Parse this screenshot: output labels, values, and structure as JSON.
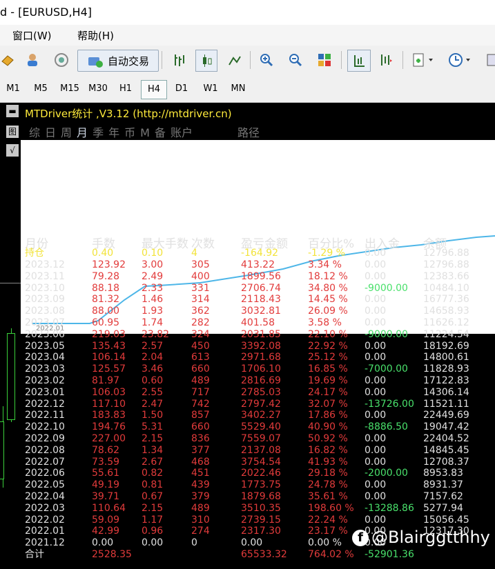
{
  "window": {
    "title": "d - [EURUSD,H4]"
  },
  "menu": {
    "window": "窗口(W)",
    "help": "帮助(H)"
  },
  "toolbar": {
    "autotrade_label": "自动交易"
  },
  "timeframes": [
    "M1",
    "M5",
    "M15",
    "M30",
    "H1",
    "H4",
    "D1",
    "W1",
    "MN"
  ],
  "active_timeframe": "H4",
  "indicator": {
    "title": "MTDriver统计 ,V3.12 (http://mtdriver.cn)",
    "tabs": [
      "综",
      "日",
      "周",
      "月",
      "季",
      "年",
      "币",
      "M",
      "备",
      "账户"
    ],
    "active_tab": "月",
    "path_label": "路径",
    "equity_x_label": "2022.01",
    "equity_line_color": "#4db6e8"
  },
  "table": {
    "headers": [
      "月份",
      "手数",
      "最大手数",
      "次数",
      "盈亏金额",
      "百分比%",
      "出入金",
      "余额"
    ],
    "position_row": [
      "持仓",
      "0.40",
      "0.10",
      "4",
      "-164.92",
      "-1.29 %",
      "0.00",
      "12796.88"
    ],
    "rows": [
      [
        "2023.12",
        "123.92",
        "3.00",
        "305",
        "413.22",
        "3.34 %",
        "0.00",
        "12796.88"
      ],
      [
        "2023.11",
        "79.28",
        "2.49",
        "400",
        "1899.56",
        "18.12 %",
        "0.00",
        "12383.66"
      ],
      [
        "2023.10",
        "88.18",
        "2.33",
        "331",
        "2706.74",
        "34.80 %",
        "-9000.00",
        "10484.10"
      ],
      [
        "2023.09",
        "81.32",
        "1.46",
        "314",
        "2118.43",
        "14.45 %",
        "0.00",
        "16777.36"
      ],
      [
        "2023.08",
        "88.00",
        "1.93",
        "362",
        "3032.81",
        "26.09 %",
        "0.00",
        "14658.93"
      ],
      [
        "2023.07",
        "60.95",
        "1.74",
        "282",
        "401.58",
        "3.58 %",
        "0.00",
        "11626.12"
      ],
      [
        "2023.06",
        "219.03",
        "23.82",
        "324",
        "2031.85",
        "22.10 %",
        "-9000.00",
        "11224.54"
      ],
      [
        "2023.05",
        "135.43",
        "2.57",
        "450",
        "3392.08",
        "22.92 %",
        "0.00",
        "18192.69"
      ],
      [
        "2023.04",
        "106.14",
        "2.04",
        "613",
        "2971.68",
        "25.12 %",
        "0.00",
        "14800.61"
      ],
      [
        "2023.03",
        "125.57",
        "3.46",
        "660",
        "1706.10",
        "16.85 %",
        "-7000.00",
        "11828.93"
      ],
      [
        "2023.02",
        "81.97",
        "0.60",
        "489",
        "2816.69",
        "19.69 %",
        "0.00",
        "17122.83"
      ],
      [
        "2023.01",
        "106.03",
        "2.55",
        "717",
        "2785.03",
        "24.17 %",
        "0.00",
        "14306.14"
      ],
      [
        "2022.12",
        "117.10",
        "2.47",
        "742",
        "2797.42",
        "32.07 %",
        "-13726.00",
        "11521.11"
      ],
      [
        "2022.11",
        "183.83",
        "1.50",
        "857",
        "3402.27",
        "17.86 %",
        "0.00",
        "22449.69"
      ],
      [
        "2022.10",
        "194.76",
        "5.31",
        "660",
        "5529.40",
        "40.90 %",
        "-8886.50",
        "19047.42"
      ],
      [
        "2022.09",
        "227.00",
        "2.15",
        "836",
        "7559.07",
        "50.92 %",
        "0.00",
        "22404.52"
      ],
      [
        "2022.08",
        "78.62",
        "1.34",
        "377",
        "2137.08",
        "16.82 %",
        "0.00",
        "14845.45"
      ],
      [
        "2022.07",
        "73.59",
        "2.67",
        "468",
        "3754.54",
        "41.93 %",
        "0.00",
        "12708.37"
      ],
      [
        "2022.06",
        "55.61",
        "0.82",
        "451",
        "2022.46",
        "29.18 %",
        "-2000.00",
        "8953.83"
      ],
      [
        "2022.05",
        "49.19",
        "0.81",
        "439",
        "1773.75",
        "24.78 %",
        "0.00",
        "8931.37"
      ],
      [
        "2022.04",
        "39.71",
        "0.67",
        "379",
        "1879.68",
        "35.61 %",
        "0.00",
        "7157.62"
      ],
      [
        "2022.03",
        "110.64",
        "2.15",
        "489",
        "3510.35",
        "198.60 %",
        "-13288.86",
        "5277.94"
      ],
      [
        "2022.02",
        "59.09",
        "1.17",
        "310",
        "2739.15",
        "22.24 %",
        "0.00",
        "15056.45"
      ],
      [
        "2022.01",
        "42.99",
        "0.96",
        "274",
        "2317.30",
        "23.17 %",
        "0.00",
        "12317.30"
      ],
      [
        "2021.12",
        "0.00",
        "0.00",
        "0",
        "0.00",
        "0.00 %",
        "0.00",
        ""
      ]
    ],
    "total_row": [
      "合计",
      "2528.35",
      "",
      "",
      "65533.32",
      "764.02 %",
      "-52901.36",
      ""
    ]
  },
  "watermark": "@Blairggtthhy",
  "colors": {
    "red": "#e23b3b",
    "yellow": "#f2e33a",
    "green": "#49e06b",
    "header": "#e0e0e0"
  }
}
